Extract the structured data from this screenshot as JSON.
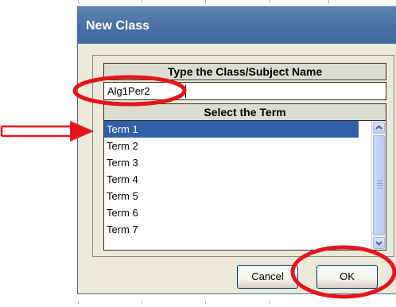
{
  "dialog": {
    "title": "New Class",
    "name_section": {
      "header": "Type the Class/Subject Name",
      "value": "Alg1Per2"
    },
    "term_section": {
      "header": "Select the Term",
      "items": [
        {
          "label": "Term 1",
          "selected": true
        },
        {
          "label": "Term 2"
        },
        {
          "label": "Term 3"
        },
        {
          "label": "Term 4"
        },
        {
          "label": "Term 5"
        },
        {
          "label": "Term 6"
        },
        {
          "label": "Term 7"
        }
      ]
    },
    "buttons": {
      "cancel": "Cancel",
      "ok": "OK"
    }
  },
  "colors": {
    "title_bar": "#4b72a3",
    "selection": "#335ea8",
    "annotation": "#e8141c"
  }
}
